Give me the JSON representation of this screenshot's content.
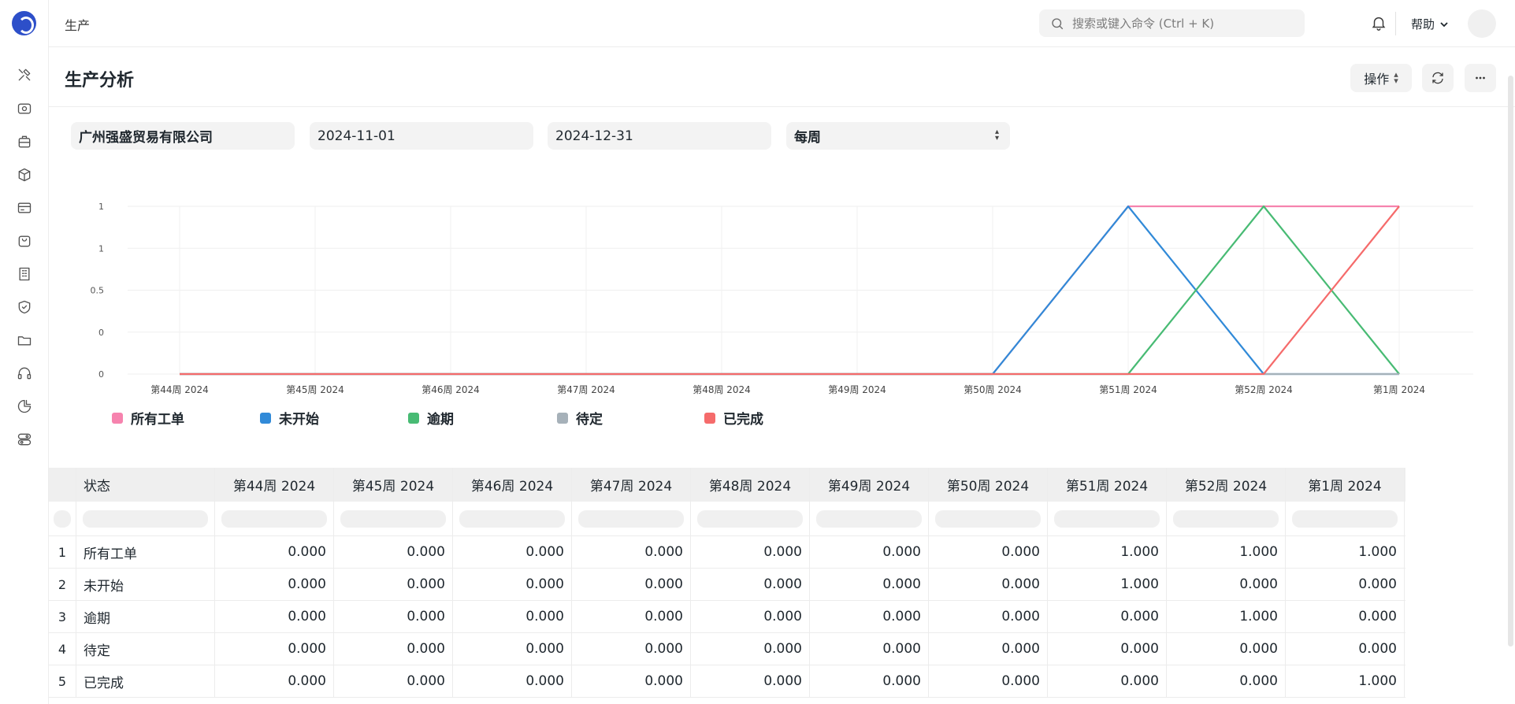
{
  "topbar": {
    "breadcrumb": "生产",
    "search_placeholder": "搜索或键入命令 (Ctrl + K)",
    "help_label": "帮助"
  },
  "sidebar": {
    "icons": [
      "tools-icon",
      "eye-icon",
      "briefcase-icon",
      "box-icon",
      "card-icon",
      "bag-icon",
      "building-icon",
      "shield-icon",
      "folder-icon",
      "headset-icon",
      "pie-chart-icon",
      "toggles-icon"
    ]
  },
  "page": {
    "title": "生产分析",
    "actions_label": "操作"
  },
  "filters": {
    "company": "广州强盛贸易有限公司",
    "from_date": "2024-11-01",
    "to_date": "2024-12-31",
    "period": "每周"
  },
  "chart_data": {
    "type": "line",
    "categories": [
      "第44周 2024",
      "第45周 2024",
      "第46周 2024",
      "第47周 2024",
      "第48周 2024",
      "第49周 2024",
      "第50周 2024",
      "第51周 2024",
      "第52周 2024",
      "第1周 2024"
    ],
    "y_tick_labels": [
      "0",
      "0",
      "0.5",
      "1",
      "1"
    ],
    "ylim": [
      0,
      1
    ],
    "grid": true,
    "legend_position": "bottom-left",
    "series": [
      {
        "name": "所有工单",
        "color": "#f683ae",
        "values": [
          0,
          0,
          0,
          0,
          0,
          0,
          0,
          1,
          1,
          1
        ]
      },
      {
        "name": "未开始",
        "color": "#318ad8",
        "values": [
          0,
          0,
          0,
          0,
          0,
          0,
          0,
          1,
          0,
          0
        ]
      },
      {
        "name": "逾期",
        "color": "#48bb74",
        "values": [
          0,
          0,
          0,
          0,
          0,
          0,
          0,
          0,
          1,
          0
        ]
      },
      {
        "name": "待定",
        "color": "#a6b1b9",
        "values": [
          0,
          0,
          0,
          0,
          0,
          0,
          0,
          0,
          0,
          0
        ]
      },
      {
        "name": "已完成",
        "color": "#f56b6b",
        "values": [
          0,
          0,
          0,
          0,
          0,
          0,
          0,
          0,
          0,
          1
        ]
      }
    ]
  },
  "table": {
    "status_header": "状态",
    "columns": [
      "第44周 2024",
      "第45周 2024",
      "第46周 2024",
      "第47周 2024",
      "第48周 2024",
      "第49周 2024",
      "第50周 2024",
      "第51周 2024",
      "第52周 2024",
      "第1周 2024"
    ],
    "rows": [
      {
        "index": "1",
        "status": "所有工单",
        "values": [
          "0.000",
          "0.000",
          "0.000",
          "0.000",
          "0.000",
          "0.000",
          "0.000",
          "1.000",
          "1.000",
          "1.000"
        ]
      },
      {
        "index": "2",
        "status": "未开始",
        "values": [
          "0.000",
          "0.000",
          "0.000",
          "0.000",
          "0.000",
          "0.000",
          "0.000",
          "1.000",
          "0.000",
          "0.000"
        ]
      },
      {
        "index": "3",
        "status": "逾期",
        "values": [
          "0.000",
          "0.000",
          "0.000",
          "0.000",
          "0.000",
          "0.000",
          "0.000",
          "0.000",
          "1.000",
          "0.000"
        ]
      },
      {
        "index": "4",
        "status": "待定",
        "values": [
          "0.000",
          "0.000",
          "0.000",
          "0.000",
          "0.000",
          "0.000",
          "0.000",
          "0.000",
          "0.000",
          "0.000"
        ]
      },
      {
        "index": "5",
        "status": "已完成",
        "values": [
          "0.000",
          "0.000",
          "0.000",
          "0.000",
          "0.000",
          "0.000",
          "0.000",
          "0.000",
          "0.000",
          "1.000"
        ]
      }
    ]
  }
}
